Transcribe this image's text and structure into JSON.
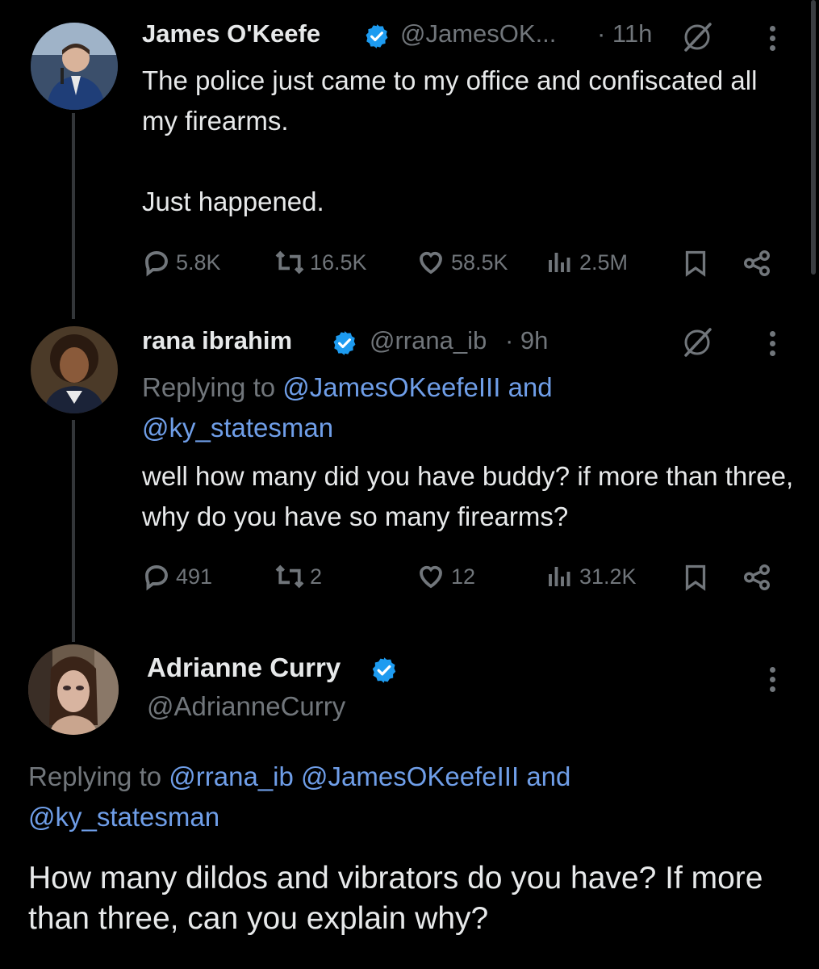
{
  "tweets": [
    {
      "name": "James O'Keefe",
      "handle": "@JamesOK...",
      "time": "· 11h",
      "text": "The police just came to my office and confiscated all my firearms.\n\nJust happened.",
      "metrics": {
        "replies": "5.8K",
        "reposts": "16.5K",
        "likes": "58.5K",
        "views": "2.5M"
      }
    },
    {
      "name": "rana ibrahim",
      "handle": "@rrana_ib",
      "time": "· 9h",
      "replying_prefix": "Replying to",
      "replying_mentions": [
        "@JamesOKeefeIII",
        "@ky_statesman"
      ],
      "replying_and": "and",
      "text": "well how many did you have buddy? if more than three, why do you have so many firearms?",
      "metrics": {
        "replies": "491",
        "reposts": "2",
        "likes": "12",
        "views": "31.2K"
      }
    },
    {
      "name": "Adrianne Curry",
      "handle": "@AdrianneCurry",
      "replying_prefix": "Replying to",
      "replying_mentions": [
        "@rrana_ib",
        "@JamesOKeefeIII",
        "@ky_statesman"
      ],
      "replying_and": "and",
      "text": "How many dildos and vibrators do you have? If more than three, can you explain why?"
    }
  ],
  "colors": {
    "background": "#000000",
    "text": "#e7e9ea",
    "muted": "#71767b",
    "link": "#6f9ee8",
    "verified": "#1d9bf0"
  },
  "icons": [
    "reply-icon",
    "repost-icon",
    "like-icon",
    "views-icon",
    "bookmark-icon",
    "share-icon",
    "grok-icon",
    "more-icon",
    "verified-badge-icon"
  ]
}
